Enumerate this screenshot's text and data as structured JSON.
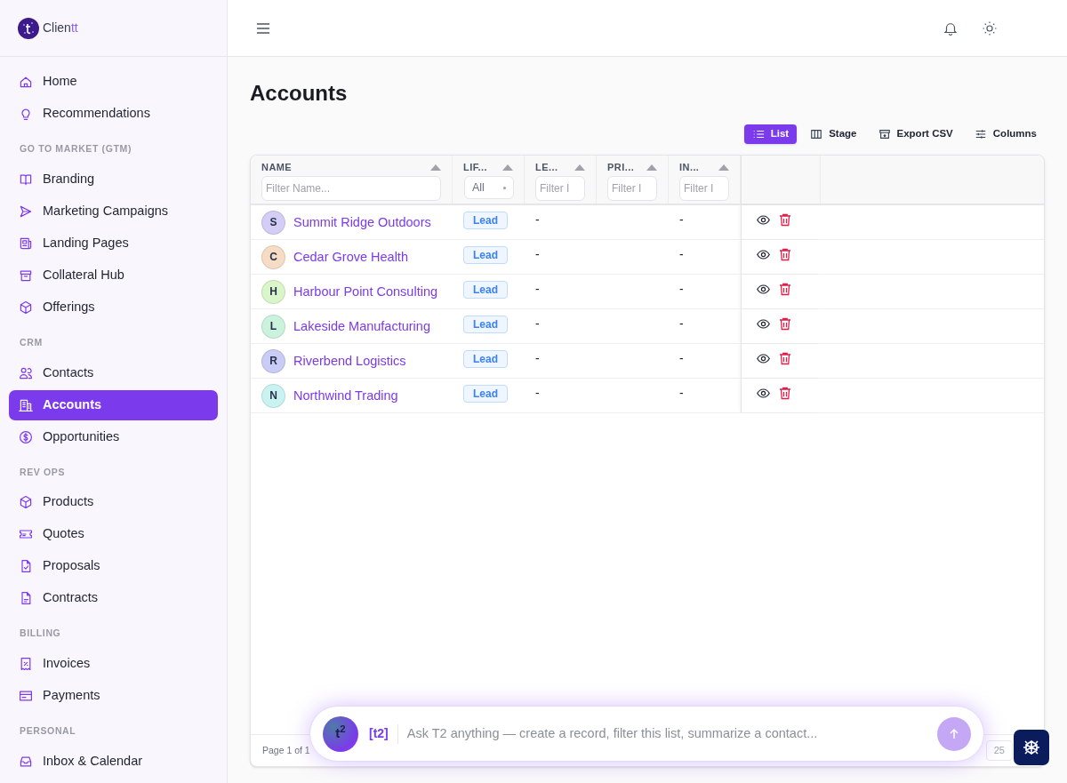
{
  "logo": {
    "text": "Clien",
    "accent": "tt"
  },
  "sidebar": {
    "sections": [
      {
        "items": [
          {
            "label": "Home",
            "selected": false
          },
          {
            "label": "Recommendations",
            "selected": false
          }
        ]
      },
      {
        "heading": "GO TO MARKET (GTM)",
        "items": [
          {
            "label": "Branding",
            "selected": false
          },
          {
            "label": "Marketing Campaigns",
            "selected": false
          },
          {
            "label": "Landing Pages",
            "selected": false
          },
          {
            "label": "Collateral Hub",
            "selected": false
          },
          {
            "label": "Offerings",
            "selected": false
          }
        ]
      },
      {
        "heading": "CRM",
        "items": [
          {
            "label": "Contacts",
            "selected": false
          },
          {
            "label": "Accounts",
            "selected": true
          },
          {
            "label": "Opportunities",
            "selected": false
          }
        ]
      },
      {
        "heading": "REV OPS",
        "items": [
          {
            "label": "Products",
            "selected": false
          },
          {
            "label": "Quotes",
            "selected": false
          },
          {
            "label": "Proposals",
            "selected": false
          },
          {
            "label": "Contracts",
            "selected": false
          }
        ]
      },
      {
        "heading": "BILLING",
        "items": [
          {
            "label": "Invoices",
            "selected": false
          },
          {
            "label": "Payments",
            "selected": false
          }
        ]
      },
      {
        "heading": "PERSONAL",
        "items": [
          {
            "label": "Inbox & Calendar",
            "selected": false
          }
        ]
      }
    ]
  },
  "page": {
    "title": "Accounts"
  },
  "view_buttons": [
    {
      "label": "List",
      "selected": true
    },
    {
      "label": "Stage",
      "selected": false
    },
    {
      "label": "Export CSV",
      "selected": false
    },
    {
      "label": "Columns",
      "selected": false
    }
  ],
  "table": {
    "columns": [
      {
        "label": "NAME",
        "filter": {
          "kind": "text",
          "placeholder": "Filter Name..."
        }
      },
      {
        "label": "LIF...",
        "filter": {
          "kind": "select",
          "value": "All"
        }
      },
      {
        "label": "LE...",
        "filter": {
          "kind": "text",
          "placeholder": "Filter I"
        }
      },
      {
        "label": "PRI...",
        "filter": {
          "kind": "text",
          "placeholder": "Filter I"
        }
      },
      {
        "label": "IN...",
        "filter": {
          "kind": "text",
          "placeholder": "Filter I"
        }
      }
    ],
    "rows": [
      {
        "initial": "S",
        "color": "#d4cdf5",
        "name": "Summit Ridge Outdoors",
        "lifecycle": "Lead",
        "column_3": "-",
        "column_5": "-"
      },
      {
        "initial": "C",
        "color": "#f6dcc4",
        "name": "Cedar Grove Health",
        "lifecycle": "Lead",
        "column_3": "-",
        "column_5": "-"
      },
      {
        "initial": "H",
        "color": "#daf5c9",
        "name": "Harbour Point Consulting",
        "lifecycle": "Lead",
        "column_3": "-",
        "column_5": "-"
      },
      {
        "initial": "L",
        "color": "#caf2dd",
        "name": "Lakeside Manufacturing",
        "lifecycle": "Lead",
        "column_3": "-",
        "column_5": "-"
      },
      {
        "initial": "R",
        "color": "#c9ccf4",
        "name": "Riverbend Logistics",
        "lifecycle": "Lead",
        "column_3": "-",
        "column_5": "-"
      },
      {
        "initial": "N",
        "color": "#c9f3f1",
        "name": "Northwind Trading",
        "lifecycle": "Lead",
        "column_3": "-",
        "column_5": "-"
      }
    ],
    "footer": {
      "page_info": "Page 1 of 1",
      "page_size": "25"
    }
  },
  "assistant": {
    "avatar": "t$^{2}$",
    "tag": "[t2]",
    "placeholder": "Ask T2 anything — create a record, filter this list, summarize a contact..."
  }
}
